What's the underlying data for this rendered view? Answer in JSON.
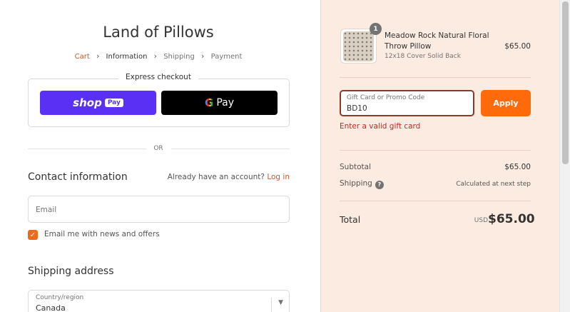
{
  "store": {
    "title": "Land of Pillows"
  },
  "breadcrumb": {
    "items": [
      {
        "label": "Cart"
      },
      {
        "label": "Information"
      },
      {
        "label": "Shipping"
      },
      {
        "label": "Payment"
      }
    ],
    "separator": "›"
  },
  "express": {
    "title": "Express checkout",
    "shop_word": "shop",
    "shop_pill": "Pay",
    "gpay_g": "G",
    "gpay_word": "Pay"
  },
  "divider": {
    "or": "OR"
  },
  "contact": {
    "title": "Contact information",
    "account_prompt": "Already have an account?",
    "login_label": "Log in",
    "email_placeholder": "Email",
    "newsletter_label": "Email me with news and offers",
    "newsletter_checked": true
  },
  "shipping": {
    "title": "Shipping address",
    "country_label": "Country/region",
    "country_value": "Canada"
  },
  "order": {
    "quantity": "1",
    "product_name": "Meadow Rock Natural Floral Throw Pillow",
    "product_variant": "12x18 Cover Solid Back",
    "product_price": "$65.00"
  },
  "promo": {
    "label": "Gift Card or Promo Code",
    "value": "BD10",
    "apply_label": "Apply",
    "error": "Enter a valid gift card"
  },
  "summary": {
    "subtotal_label": "Subtotal",
    "subtotal_value": "$65.00",
    "shipping_label": "Shipping",
    "shipping_value": "Calculated at next step",
    "total_label": "Total",
    "currency": "USD",
    "total_value": "$65.00"
  },
  "colors": {
    "accent": "#ff6b0a",
    "link": "#c55b2c",
    "shop_pay": "#5a31f4",
    "summary_bg": "#fbebe1",
    "error": "#b0302a"
  }
}
